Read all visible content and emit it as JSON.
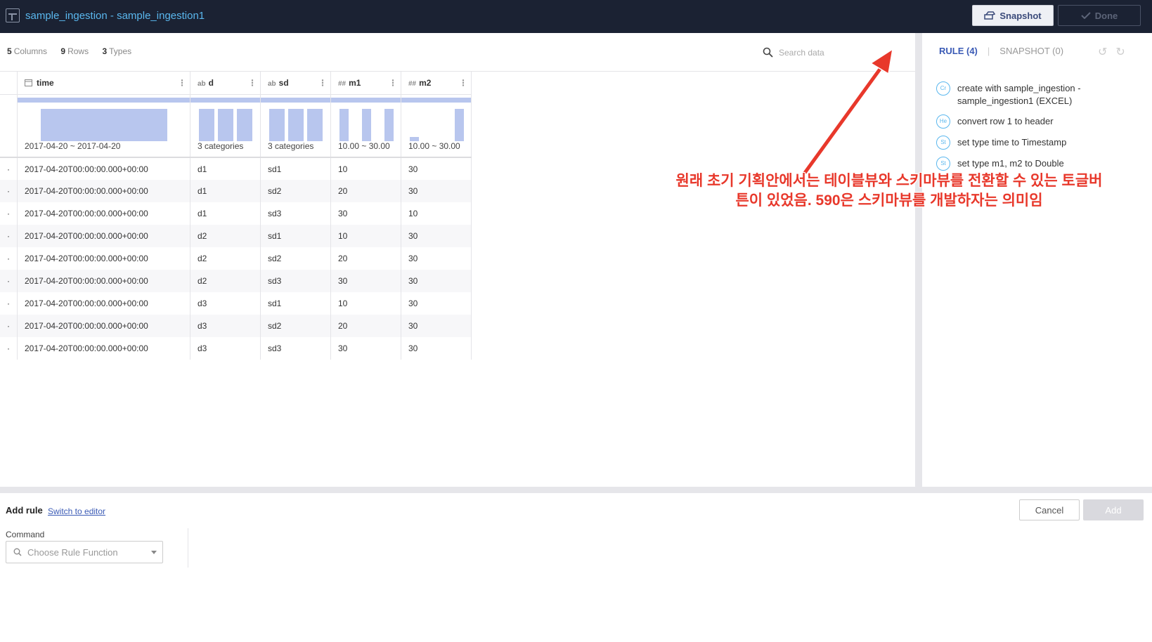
{
  "header": {
    "title": "sample_ingestion - sample_ingestion1",
    "snapshot_label": "Snapshot",
    "done_label": "Done"
  },
  "summary": {
    "columns_count": "5",
    "columns_label": "Columns",
    "rows_count": "9",
    "rows_label": "Rows",
    "types_count": "3",
    "types_label": "Types"
  },
  "search": {
    "placeholder": "Search data"
  },
  "columns": [
    {
      "type_icon": "calendar-icon",
      "type_label": "",
      "name": "time",
      "summary": "2017-04-20 ~ 2017-04-20"
    },
    {
      "type_icon": "string-type-icon",
      "type_label": "ab",
      "name": "d",
      "summary": "3 categories"
    },
    {
      "type_icon": "string-type-icon",
      "type_label": "ab",
      "name": "sd",
      "summary": "3 categories"
    },
    {
      "type_icon": "number-type-icon",
      "type_label": "##",
      "name": "m1",
      "summary": "10.00 ~ 30.00"
    },
    {
      "type_icon": "number-type-icon",
      "type_label": "##",
      "name": "m2",
      "summary": "10.00 ~ 30.00"
    }
  ],
  "rows": [
    [
      "2017-04-20T00:00:00.000+00:00",
      "d1",
      "sd1",
      "10",
      "30"
    ],
    [
      "2017-04-20T00:00:00.000+00:00",
      "d1",
      "sd2",
      "20",
      "30"
    ],
    [
      "2017-04-20T00:00:00.000+00:00",
      "d1",
      "sd3",
      "30",
      "10"
    ],
    [
      "2017-04-20T00:00:00.000+00:00",
      "d2",
      "sd1",
      "10",
      "30"
    ],
    [
      "2017-04-20T00:00:00.000+00:00",
      "d2",
      "sd2",
      "20",
      "30"
    ],
    [
      "2017-04-20T00:00:00.000+00:00",
      "d2",
      "sd3",
      "30",
      "30"
    ],
    [
      "2017-04-20T00:00:00.000+00:00",
      "d3",
      "sd1",
      "10",
      "30"
    ],
    [
      "2017-04-20T00:00:00.000+00:00",
      "d3",
      "sd2",
      "20",
      "30"
    ],
    [
      "2017-04-20T00:00:00.000+00:00",
      "d3",
      "sd3",
      "30",
      "30"
    ]
  ],
  "rules_panel": {
    "tab_rule": "RULE (4)",
    "tab_snapshot": "SNAPSHOT (0)",
    "rules": [
      {
        "badge": "Cr",
        "text": "create with sample_ingestion - sample_ingestion1 (EXCEL)"
      },
      {
        "badge": "He",
        "text": "convert row 1 to header"
      },
      {
        "badge": "St",
        "text": "set type time to Timestamp"
      },
      {
        "badge": "St",
        "text": "set type m1, m2 to Double"
      }
    ]
  },
  "annotation": {
    "line1": "원래 초기 기획안에서는 테이블뷰와 스키마뷰를 전환할 수 있는 토글버",
    "line2": "튼이 있었음. 590은 스키마뷰를 개발하자는 의미임"
  },
  "add_rule": {
    "title": "Add rule",
    "switch_link": "Switch to editor",
    "command_label": "Command",
    "command_placeholder": "Choose Rule Function",
    "cancel_label": "Cancel",
    "add_label": "Add"
  },
  "colors": {
    "header_bg": "#1b2233",
    "accent": "#5ab7ee",
    "link": "#3a5ab5",
    "annotation": "#e8382b",
    "histogram": "#b8c6ee"
  }
}
